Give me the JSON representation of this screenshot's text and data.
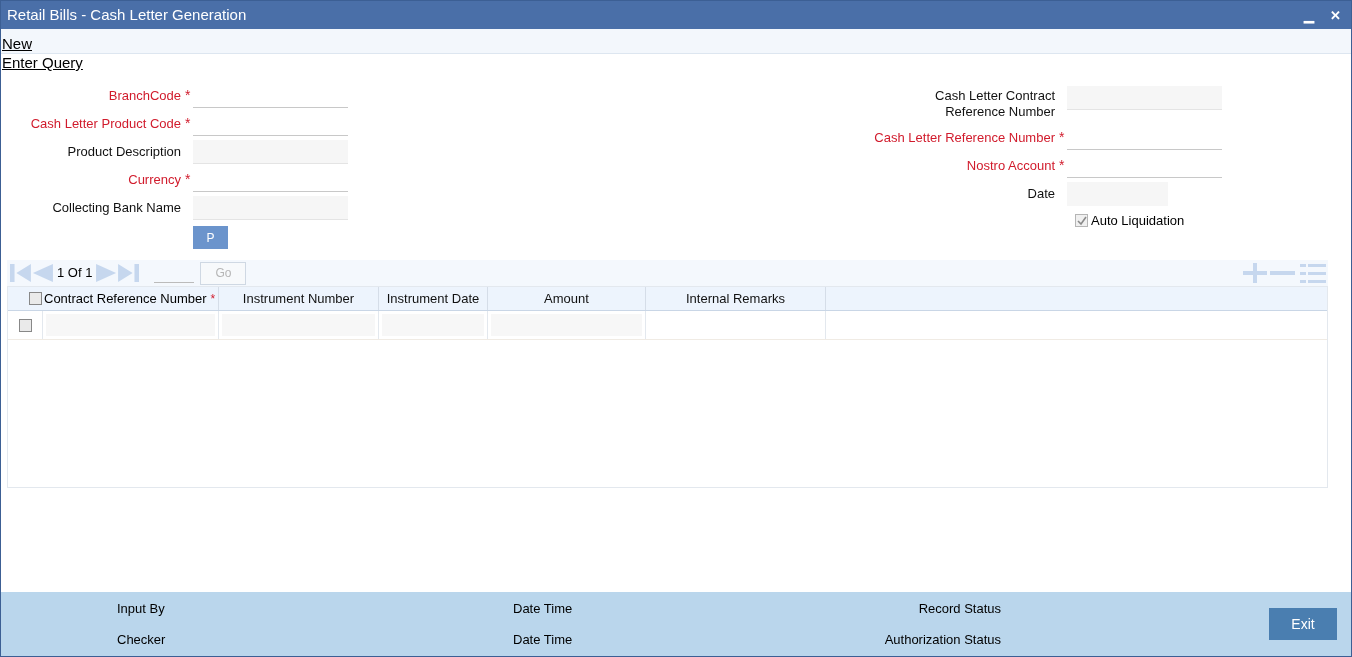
{
  "window": {
    "title": "Retail Bills - Cash Letter Generation",
    "controls": [
      "▁",
      "✕"
    ]
  },
  "menu": [
    "New",
    "Enter Query"
  ],
  "left_fields": [
    {
      "label": "BranchCode",
      "required": true,
      "kind": "input"
    },
    {
      "label": "Cash Letter Product Code",
      "required": true,
      "kind": "input"
    },
    {
      "label": "Product Description",
      "required": false,
      "kind": "readonly"
    },
    {
      "label": "Currency",
      "required": true,
      "kind": "input"
    },
    {
      "label": "Collecting Bank Name",
      "required": false,
      "kind": "readonly"
    }
  ],
  "populate_button": "P",
  "right_fields": [
    {
      "label": "Cash Letter Contract Reference Number",
      "required": false,
      "kind": "readonly"
    },
    {
      "label": "Cash Letter Reference Number",
      "required": true,
      "kind": "input"
    },
    {
      "label": "Nostro Account",
      "required": true,
      "kind": "input"
    },
    {
      "label": "Date",
      "required": false,
      "kind": "short"
    }
  ],
  "auto_liquidation": {
    "label": "Auto Liquidation",
    "checked": true,
    "disabled": true
  },
  "grid": {
    "pager": "1 Of 1",
    "go": "Go",
    "columns": [
      {
        "label": "Contract Reference Number",
        "required": true
      },
      {
        "label": "Instrument Number",
        "required": false
      },
      {
        "label": "Instrument Date",
        "required": false
      },
      {
        "label": "Amount",
        "required": false
      },
      {
        "label": "Internal Remarks",
        "required": false
      }
    ],
    "rows": [
      {
        "checked": false
      }
    ],
    "header_checked": false
  },
  "footer": [
    {
      "label": "Input By"
    },
    {
      "label": "Date Time"
    },
    {
      "label": "Record Status"
    },
    {
      "label": "Checker"
    },
    {
      "label": "Date Time"
    },
    {
      "label": "Authorization Status"
    }
  ],
  "required_mark": "*",
  "exit_button": "Exit"
}
